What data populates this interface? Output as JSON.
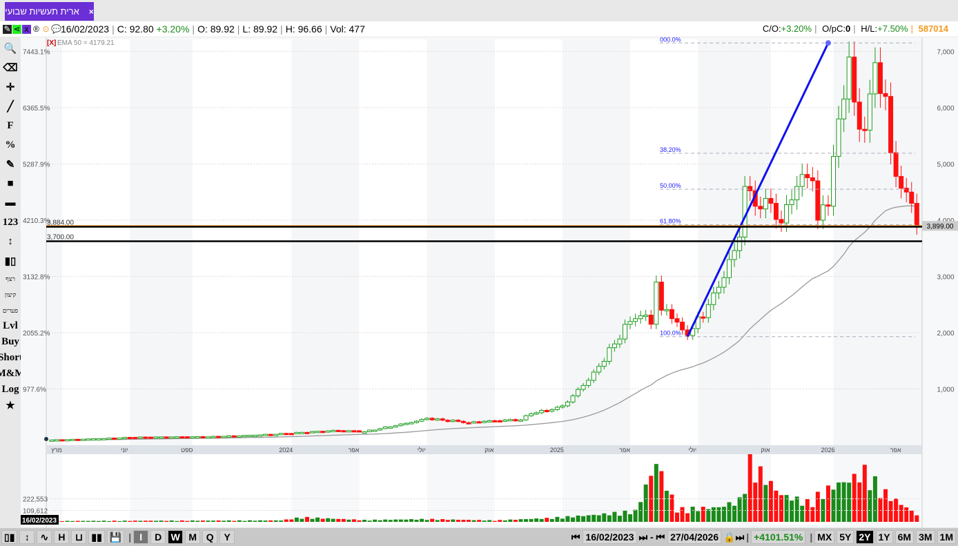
{
  "tab": {
    "title": "ארית תעשיות שבועי",
    "close": "×"
  },
  "info": {
    "date": "16/02/2023",
    "c_label": "C:",
    "c": "92.80",
    "chg": "+3.20%",
    "o_label": "O:",
    "o": "89.92",
    "l_label": "L:",
    "l": "89.92",
    "h_label": "H:",
    "h": "96.66",
    "vol_label": "Vol:",
    "vol": "477",
    "co_label": "C/O:",
    "co": "+3.20%",
    "opc_label": "O/pC:",
    "opc": "0",
    "hl_label": "H/L:",
    "hl": "+7.50%",
    "id": "587014"
  },
  "sidebar": [
    {
      "name": "search-icon",
      "t": "🔍"
    },
    {
      "name": "eraser-icon",
      "t": "⌫"
    },
    {
      "name": "crosshair-icon",
      "t": "✛"
    },
    {
      "name": "line-icon",
      "t": "╱"
    },
    {
      "name": "fib-icon",
      "t": "F"
    },
    {
      "name": "percent-icon",
      "t": "%"
    },
    {
      "name": "edit-icon",
      "t": "✎"
    },
    {
      "name": "color-icon",
      "t": "■"
    },
    {
      "name": "thickness-icon",
      "t": "▬"
    },
    {
      "name": "measure-icon",
      "t": "123"
    },
    {
      "name": "vertical-icon",
      "t": "↕"
    },
    {
      "name": "candles-icon",
      "t": "▮▯"
    },
    {
      "name": "tool-continuous",
      "t": "רצף"
    },
    {
      "name": "tool-extreme",
      "t": "קיצון"
    },
    {
      "name": "tool-gaps",
      "t": "פערים"
    },
    {
      "name": "tool-lvl",
      "t": "Lvl"
    },
    {
      "name": "tool-buy",
      "t": "Buy"
    },
    {
      "name": "tool-short",
      "t": "Short"
    },
    {
      "name": "tool-mm",
      "t": "M&M"
    },
    {
      "name": "tool-log",
      "t": "Log"
    },
    {
      "name": "star-icon",
      "t": "★"
    }
  ],
  "bottom": {
    "types": [
      "▯▮",
      "↕",
      "∿",
      "H",
      "⊔",
      "▮▮",
      "💾"
    ],
    "periods": [
      "I",
      "D",
      "W",
      "M",
      "Q",
      "Y"
    ],
    "selected_period": "W",
    "start": "16/02/2023",
    "end": "27/04/2026",
    "change": "+4101.51%",
    "ranges": [
      "MX",
      "5Y",
      "2Y",
      "1Y",
      "6M",
      "3M",
      "1M"
    ],
    "selected_range": "2Y"
  },
  "colors": {
    "up": "#1a9a1a",
    "down": "#ff1010",
    "accent": "#6b2fd6",
    "fib": "#2020ff"
  },
  "chart_data": {
    "type": "candlestick",
    "indicator": "EMA 50 = 4179.21",
    "indicator_close": "[X]",
    "y_right_ticks": [
      "7,000",
      "6,000",
      "5,000",
      "4,000",
      "3,000",
      "2,000",
      "1,000"
    ],
    "y_right_values": [
      7000,
      6000,
      5000,
      4000,
      3000,
      2000,
      1000
    ],
    "y_left_ticks": [
      "7443.1%",
      "6365.5%",
      "5287.9%",
      "4210.3%",
      "3132.8%",
      "2055.2%",
      "977.6%"
    ],
    "x_ticks": [
      {
        "w": 2,
        "t": "מרץ"
      },
      {
        "w": 15,
        "t": "יוני"
      },
      {
        "w": 27,
        "t": "ספט"
      },
      {
        "w": 46,
        "t": "2024"
      },
      {
        "w": 59,
        "t": "אפר"
      },
      {
        "w": 72,
        "t": "יולי"
      },
      {
        "w": 85,
        "t": "אוק"
      },
      {
        "w": 98,
        "t": "2025"
      },
      {
        "w": 111,
        "t": "אפר"
      },
      {
        "w": 124,
        "t": "יולי"
      },
      {
        "w": 138,
        "t": "אוק"
      },
      {
        "w": 150,
        "t": "2026"
      },
      {
        "w": 163,
        "t": "אפר"
      }
    ],
    "weeks": 167,
    "close_keypoints": [
      [
        0,
        93
      ],
      [
        15,
        140
      ],
      [
        30,
        150
      ],
      [
        45,
        210
      ],
      [
        55,
        260
      ],
      [
        60,
        240
      ],
      [
        72,
        480
      ],
      [
        80,
        400
      ],
      [
        86,
        430
      ],
      [
        90,
        450
      ],
      [
        92,
        560
      ],
      [
        98,
        700
      ],
      [
        104,
        1300
      ],
      [
        108,
        1800
      ],
      [
        111,
        2200
      ],
      [
        113,
        2300
      ],
      [
        115,
        2150
      ],
      [
        116,
        2900
      ],
      [
        117,
        2400
      ],
      [
        119,
        2250
      ],
      [
        121,
        2050
      ],
      [
        122,
        1950
      ],
      [
        126,
        2500
      ],
      [
        130,
        3300
      ],
      [
        132,
        3700
      ],
      [
        133,
        4600
      ],
      [
        136,
        4200
      ],
      [
        138,
        4300
      ],
      [
        140,
        3950
      ],
      [
        143,
        4600
      ],
      [
        146,
        4700
      ],
      [
        147,
        4000
      ],
      [
        149,
        4250
      ],
      [
        151,
        5800
      ],
      [
        153,
        6900
      ],
      [
        154,
        6100
      ],
      [
        156,
        5600
      ],
      [
        158,
        6800
      ],
      [
        160,
        6200
      ],
      [
        161,
        5200
      ],
      [
        164,
        4500
      ],
      [
        165,
        4300
      ],
      [
        166,
        3899
      ]
    ],
    "volume_keypoints": [
      [
        0,
        5000
      ],
      [
        44,
        8000
      ],
      [
        48,
        25000
      ],
      [
        60,
        10000
      ],
      [
        72,
        15000
      ],
      [
        85,
        8000
      ],
      [
        95,
        20000
      ],
      [
        105,
        40000
      ],
      [
        112,
        60000
      ],
      [
        116,
        330000
      ],
      [
        120,
        70000
      ],
      [
        128,
        80000
      ],
      [
        132,
        120000
      ],
      [
        134,
        335000
      ],
      [
        140,
        150000
      ],
      [
        145,
        110000
      ],
      [
        150,
        200000
      ],
      [
        153,
        230000
      ],
      [
        156,
        280000
      ],
      [
        160,
        160000
      ],
      [
        166,
        40000
      ]
    ],
    "volume_ticks": [
      "222,553",
      "109,612"
    ],
    "volume_tick_values": [
      222553,
      109612
    ],
    "levels": [
      {
        "label": "3,884.00",
        "value": 3884
      },
      {
        "label": "3,700.00",
        "value": 3700
      }
    ],
    "last_price": "3,899.00",
    "fib": [
      {
        "label": "000.0%",
        "value": 7150
      },
      {
        "label": "38.20%",
        "value": 5190
      },
      {
        "label": "50.00%",
        "value": 4550
      },
      {
        "label": "61.80%",
        "value": 3920
      },
      {
        "label": "100.0%",
        "value": 1930
      }
    ],
    "trendline": {
      "from": [
        122,
        1930
      ],
      "to": [
        149,
        7150
      ]
    },
    "volume_date_label": "16/02/2023"
  }
}
